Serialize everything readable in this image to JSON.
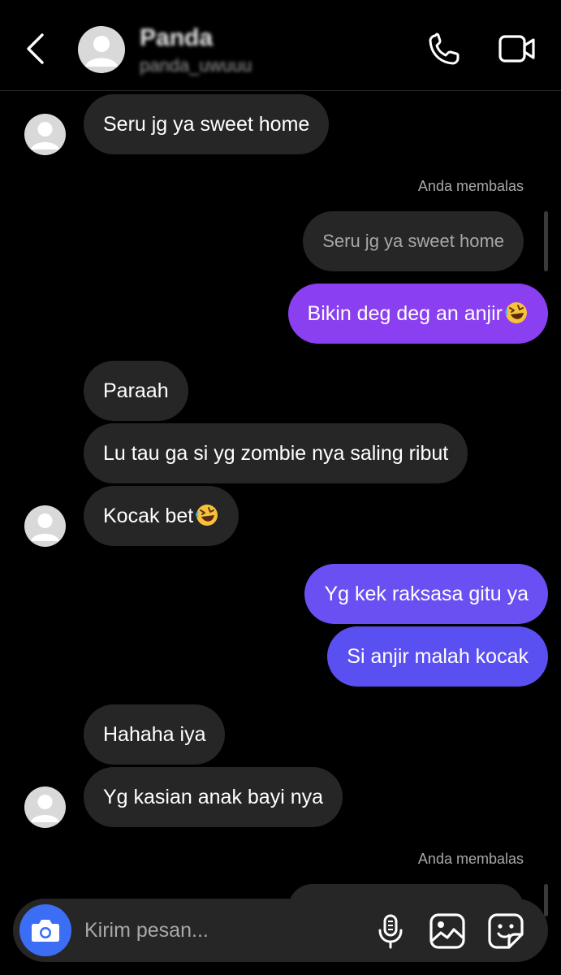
{
  "header": {
    "name": "Panda",
    "username": "panda_uwuuu",
    "back_icon": "chevron-left-icon",
    "call_icon": "phone-icon",
    "video_icon": "video-camera-icon"
  },
  "messages": [
    {
      "side": "in",
      "text": "Seru jg ya sweet home"
    },
    {
      "side": "label",
      "text": "Anda membalas"
    },
    {
      "side": "reply",
      "text": "Seru jg ya sweet home"
    },
    {
      "side": "out",
      "text": "Bikin deg deg an anjir",
      "emoji": "rofl-emoji"
    },
    {
      "side": "in",
      "text": "Paraah"
    },
    {
      "side": "in",
      "text": "Lu tau ga si yg zombie nya saling ribut"
    },
    {
      "side": "in",
      "text": "Kocak bet",
      "emoji": "rofl-emoji"
    },
    {
      "side": "out",
      "text": "Yg kek raksasa gitu ya"
    },
    {
      "side": "out",
      "text": "Si anjir malah kocak"
    },
    {
      "side": "in",
      "text": "Hahaha iya"
    },
    {
      "side": "in",
      "text": "Yg kasian anak bayi nya"
    },
    {
      "side": "label",
      "text": "Anda membalas"
    }
  ],
  "composer": {
    "placeholder": "Kirim pesan...",
    "camera_icon": "camera-icon",
    "mic_icon": "microphone-icon",
    "gallery_icon": "image-icon",
    "sticker_icon": "sticker-icon"
  },
  "colors": {
    "background": "#000000",
    "incoming_bubble": "#262626",
    "outgoing_purple": "#8a3ff0",
    "outgoing_indigo": "#5a4ff0",
    "camera_button": "#3b6ef5"
  }
}
